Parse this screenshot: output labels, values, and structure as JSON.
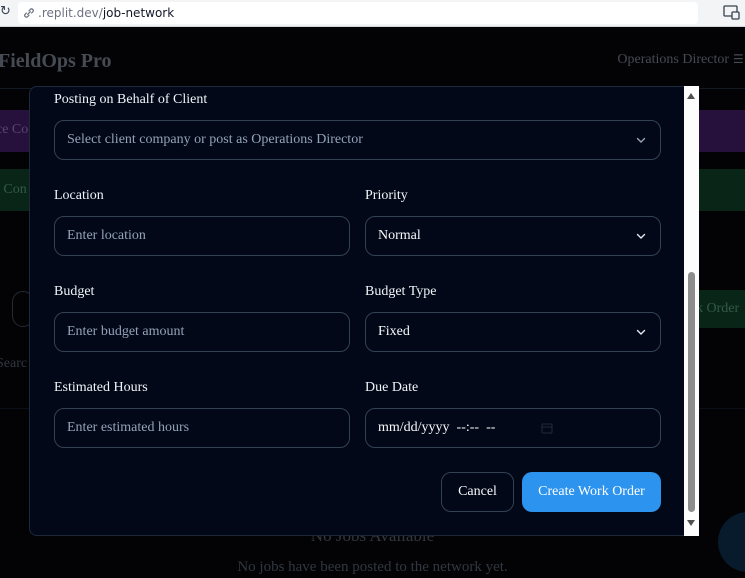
{
  "browser": {
    "url_host": ".replit.dev/",
    "url_path": "job-network"
  },
  "app": {
    "brand": "FieldOps Pro",
    "user_role": "Operations Director",
    "bg_purple_text": "ce Co",
    "bg_green_text": "t Con",
    "bg_workorder_text": "k Order",
    "bg_search_text": "Searc",
    "empty_title": "No Jobs Available",
    "empty_subtitle": "No jobs have been posted to the network yet."
  },
  "modal": {
    "client": {
      "label": "Posting on Behalf of Client",
      "placeholder": "Select client company or post as Operations Director"
    },
    "location": {
      "label": "Location",
      "placeholder": "Enter location"
    },
    "priority": {
      "label": "Priority",
      "value": "Normal"
    },
    "budget": {
      "label": "Budget",
      "placeholder": "Enter budget amount"
    },
    "budget_type": {
      "label": "Budget Type",
      "value": "Fixed"
    },
    "estimated_hours": {
      "label": "Estimated Hours",
      "placeholder": "Enter estimated hours"
    },
    "due_date": {
      "label": "Due Date",
      "placeholder": "mm/dd/yyyy  --:--  --"
    },
    "cancel_label": "Cancel",
    "create_label": "Create Work Order"
  },
  "colors": {
    "accent": "#2c93ee",
    "modal_bg": "#020817",
    "border": "#334155"
  },
  "icons": [
    "reload-icon",
    "link-icon",
    "cast-icon",
    "menu-icon",
    "chevron-down-icon",
    "calendar-icon",
    "scroll-up-arrow-icon",
    "scroll-down-arrow-icon"
  ]
}
